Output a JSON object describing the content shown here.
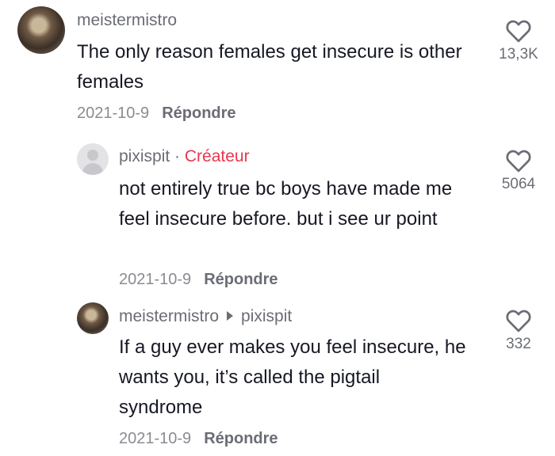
{
  "comments": [
    {
      "username": "meistermistro",
      "text": "The only reason females get insecure is other females",
      "date": "2021-10-9",
      "reply_label": "Répondre",
      "likes": "13,3K"
    },
    {
      "username": "pixispit",
      "separator": "·",
      "badge": "Créateur",
      "text": "not entirely true bc boys have made me feel insecure before. but i see ur point",
      "date": "2021-10-9",
      "reply_label": "Répondre",
      "likes": "5064"
    },
    {
      "username": "meistermistro",
      "reply_to": "pixispit",
      "text": "If a guy ever makes you feel insecure, he wants you, it’s called the pigtail syndrome",
      "date": "2021-10-9",
      "reply_label": "Répondre",
      "likes": "332"
    }
  ],
  "icons": {
    "like": "heart-outline-icon",
    "reply_arrow": "caret-right-icon"
  },
  "colors": {
    "creator_badge": "#e8374f",
    "text": "#161823",
    "muted": "#6b6d75"
  }
}
